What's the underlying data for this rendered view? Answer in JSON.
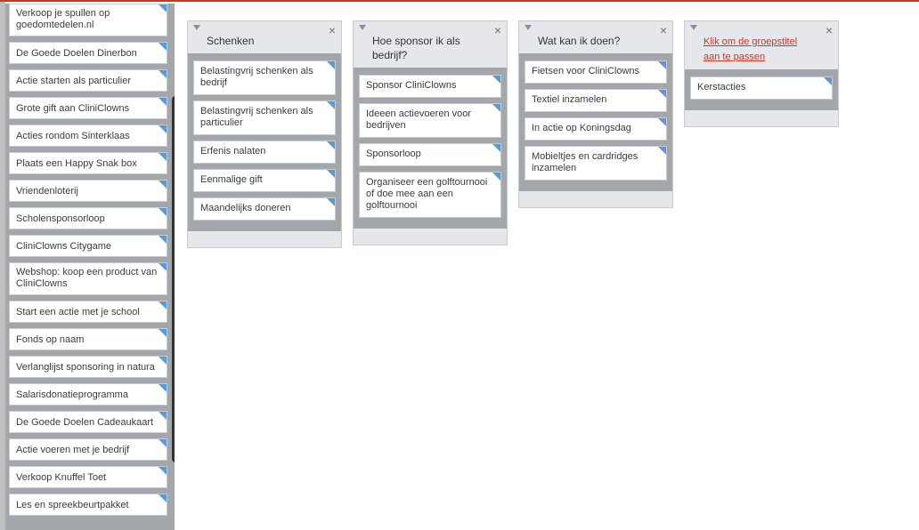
{
  "sidebar": {
    "items": [
      "Verkoop je spullen op goedomtedelen.nl",
      "De Goede Doelen Dinerbon",
      "Actie starten als particulier",
      "Grote gift aan CliniClowns",
      "Acties rondom Sinterklaas",
      "Plaats een Happy Snak box",
      "Vriendenloterij",
      "Scholensponsorloop",
      "CliniClowns Citygame",
      "Webshop: koop een product van CliniClowns",
      "Start een actie met je school",
      "Fonds op naam",
      "Verlanglijst sponsoring in natura",
      "Salarisdonatieprogramma",
      "De Goede Doelen Cadeaukaart",
      "Actie voeren met je bedrijf",
      "Verkoop Knuffel Toet",
      "Les en spreekbeurtpakket"
    ]
  },
  "groups": [
    {
      "title": "Schenken",
      "close": "×",
      "items": [
        "Belastingvrij schenken als bedrijf",
        "Belastingvrij schenken als particulier",
        "Erfenis nalaten",
        "Eenmalige gift",
        "Maandelijks doneren"
      ]
    },
    {
      "title": "Hoe sponsor ik als bedrijf?",
      "close": "×",
      "items": [
        "Sponsor CliniClowns",
        "Ideeen actievoeren voor bedrijven",
        "Sponsorloop",
        "Organiseer een golftournooi of doe mee aan een golftournooi"
      ]
    },
    {
      "title": "Wat kan ik doen?",
      "close": "×",
      "items": [
        "Fietsen voor CliniClowns",
        "Textiel inzamelen",
        "In actie op Koningsdag",
        "Mobieltjes en cardridges inzamelen"
      ]
    },
    {
      "title": "Klik om de groepstitel aan te passen",
      "close": "×",
      "items": [
        "Kerstacties"
      ]
    }
  ],
  "colors": {
    "accent": "#c0392b",
    "corner": "#5b9bd5",
    "panel": "#a3a7ab"
  }
}
